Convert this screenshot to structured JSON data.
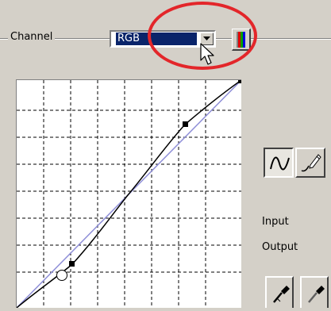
{
  "channel": {
    "label": "Channel",
    "selected_value": "RGB"
  },
  "curve_panel": {
    "input_label": "Input",
    "output_label": "Output"
  },
  "icons": {
    "dropdown": "chevron-down-icon",
    "color_toggle": "rgb-channels-icon",
    "curve_mode": "smooth-curve-icon",
    "freehand_mode": "pencil-icon",
    "eyedropper": "eyedropper-icon",
    "cursor": "arrow-cursor-icon"
  },
  "colors": {
    "selection": "#0a246a",
    "highlight_ellipse": "#e3262a",
    "reference_line": "#8f8fd8",
    "curve": "#000000"
  }
}
